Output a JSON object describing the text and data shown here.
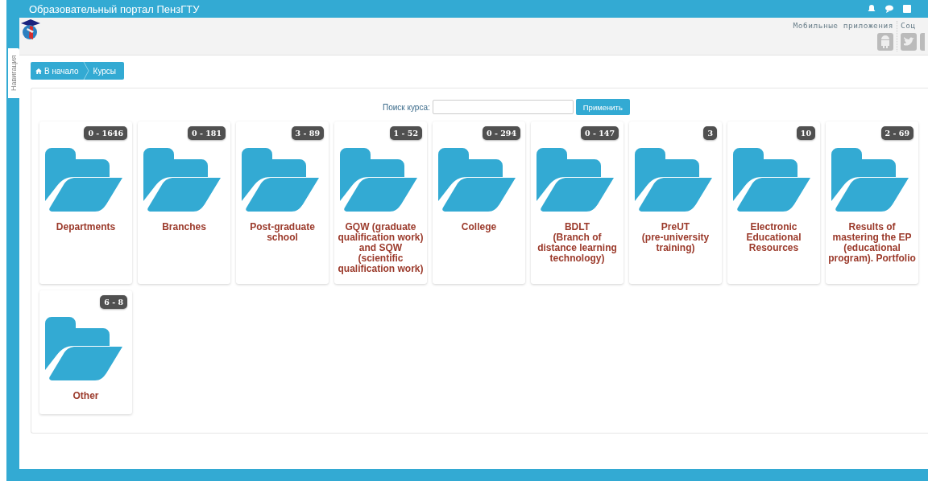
{
  "top_bar": {
    "title": "Образовательный портал ПензГТУ"
  },
  "nav_tab": {
    "label": "Навигация"
  },
  "header": {
    "mobile_apps": "Мобильные приложения",
    "social": "Соц"
  },
  "breadcrumb": [
    {
      "label": "В начало",
      "kind": "home"
    },
    {
      "label": "Курсы",
      "kind": "page"
    }
  ],
  "search": {
    "label": "Поиск курса:",
    "button": "Применить"
  },
  "categories": [
    {
      "name": "Departments",
      "count": "0 - 1646"
    },
    {
      "name": "Branches",
      "count": "0 - 181"
    },
    {
      "name": "Post-graduate school",
      "count": "3 - 89"
    },
    {
      "name": "GQW (graduate qualification work) and SQW (scientific qualification work)",
      "count": "1 - 52"
    },
    {
      "name": "College",
      "count": "0 - 294"
    },
    {
      "name": "BDLT\n(Branch of distance learning technology)",
      "count": "0 - 147"
    },
    {
      "name": "PreUT\n(pre-university training)",
      "count": "3"
    },
    {
      "name": "Electronic Educational Resources",
      "count": "10"
    },
    {
      "name": "Results of mastering the EP (educational program). Portfolio",
      "count": "2 - 69"
    },
    {
      "name": "Other",
      "count": "6 - 8"
    }
  ]
}
